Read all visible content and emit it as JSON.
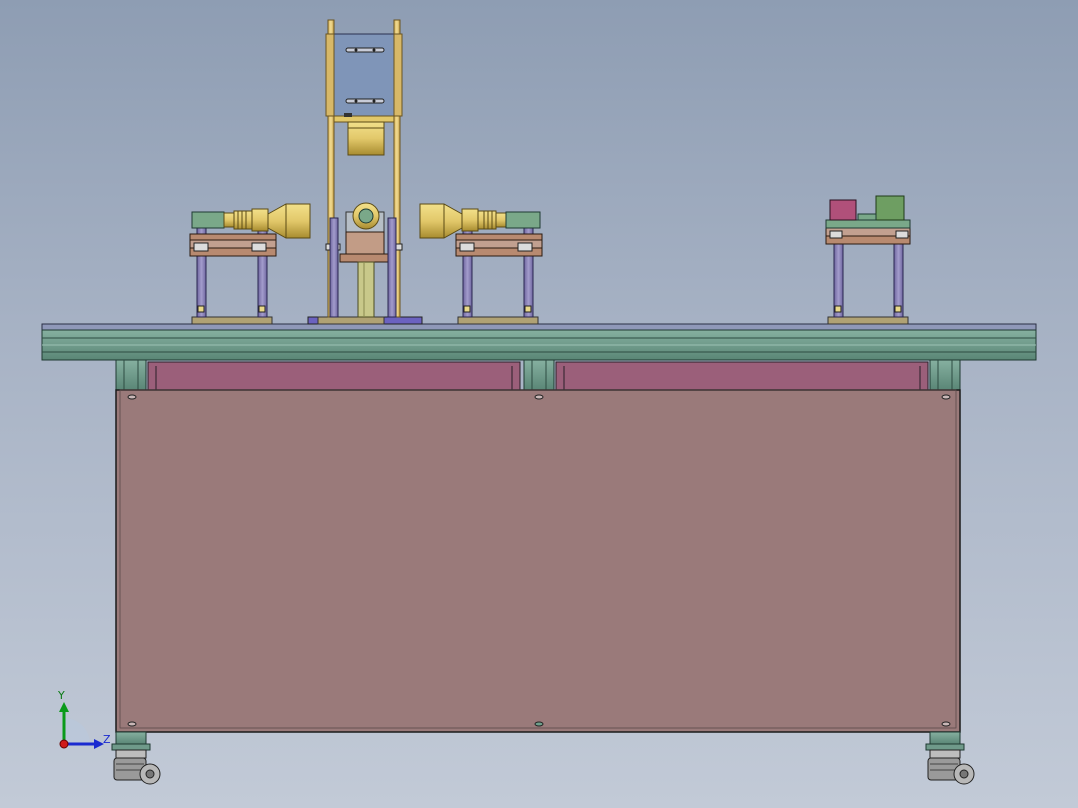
{
  "viewport": {
    "background_top": "#8e9db3",
    "background_bottom": "#c2cad7"
  },
  "colors": {
    "frame_green": "#6f9a8a",
    "frame_green_dark": "#3f6a5c",
    "top_plate": "#8f98b8",
    "panel_body": "#9a7a7a",
    "panel_inset": "#9b5f7a",
    "brass": "#e2c86a",
    "brass_dark": "#9a8230",
    "column": "#8c84b8",
    "bracket": "#b88a70",
    "acrylic": "#7f95b8",
    "motor_magenta": "#b0507a",
    "motor_green": "#6e9e62"
  },
  "triad": {
    "x_axis_label": "Z",
    "y_axis_label": "Y",
    "icon": "coordinate-triad-icon"
  },
  "components": [
    {
      "name": "vertical-lift-tower",
      "icon": "lift-tower-icon"
    },
    {
      "name": "left-lens-module",
      "icon": "lens-icon"
    },
    {
      "name": "right-lens-module",
      "icon": "lens-icon"
    },
    {
      "name": "center-fixture",
      "icon": "fixture-icon"
    },
    {
      "name": "motor-module",
      "icon": "motor-icon"
    },
    {
      "name": "machine-table",
      "icon": "table-icon"
    },
    {
      "name": "caster-wheels",
      "icon": "caster-icon"
    }
  ]
}
